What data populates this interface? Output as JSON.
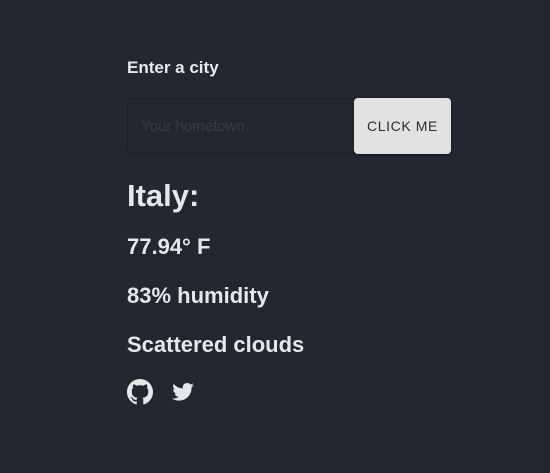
{
  "form": {
    "label": "Enter a city",
    "input_placeholder": "Your hometown.",
    "input_value": "",
    "button_label": "CLICK ME"
  },
  "weather": {
    "country": "Italy:",
    "temperature": "77.94° F",
    "humidity": "83% humidity",
    "description": "Scattered clouds"
  },
  "social": {
    "icons": [
      "github-icon",
      "twitter-icon"
    ]
  },
  "colors": {
    "background": "#222730",
    "text": "#e6e7e8",
    "button_bg": "#e2e2e2",
    "button_text": "#2a2d33"
  }
}
